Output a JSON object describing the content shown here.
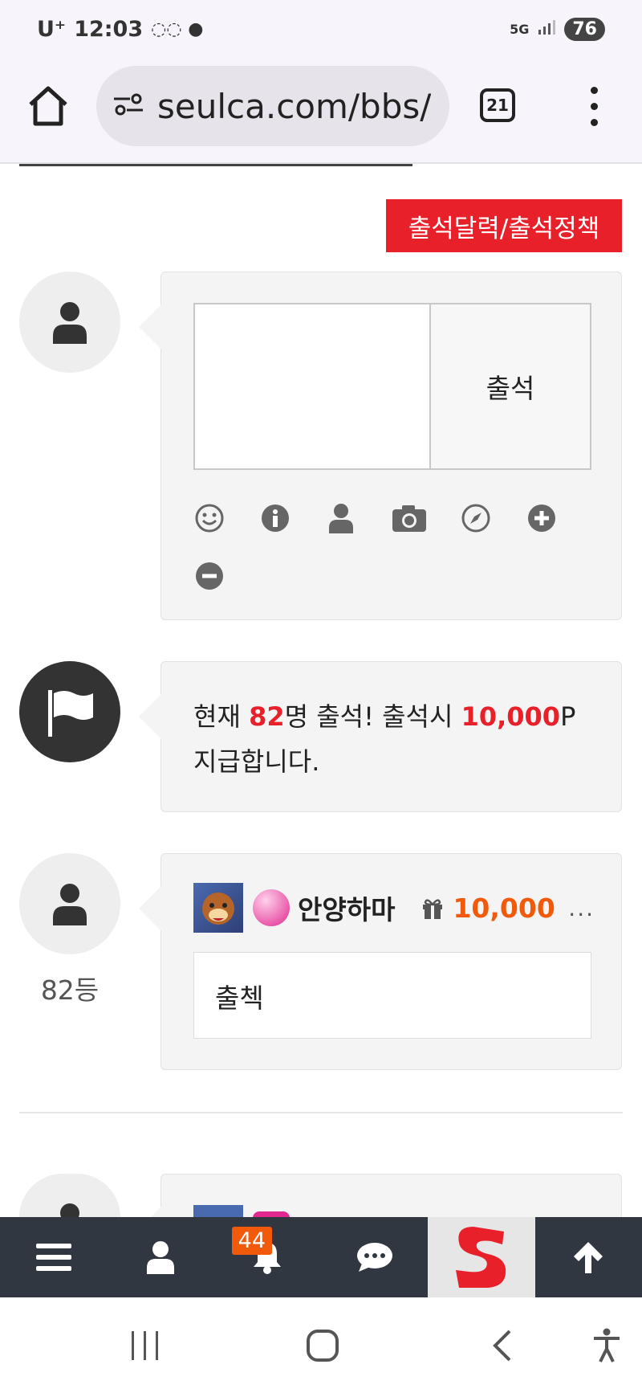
{
  "status_bar": {
    "carrier": "U⁺",
    "time": "12:03",
    "network": "5G",
    "battery": "76"
  },
  "browser": {
    "url": "seulca.com/bbs/",
    "tab_count": "21"
  },
  "page": {
    "calendar_button": "출석달력/출석정책",
    "attendance_form": {
      "submit_label": "출석",
      "input_value": "",
      "tools": [
        "smiley-icon",
        "info-icon",
        "user-icon",
        "camera-icon",
        "compass-icon",
        "plus-circle-icon",
        "minus-circle-icon"
      ]
    },
    "notice": {
      "prefix": "현재 ",
      "count": "82",
      "mid": "명 출석! 출석시 ",
      "points": "10,000",
      "suffix": "P",
      "line2": "지급합니다."
    },
    "comments": [
      {
        "rank": "82등",
        "author": "안양하마",
        "points": "10,000",
        "more": "...",
        "text": "출첵"
      }
    ]
  },
  "bottom_nav": {
    "notification_count": "44",
    "items": [
      "menu-icon",
      "user-icon",
      "bell-icon",
      "chat-icon",
      "logo",
      "arrow-up-icon"
    ]
  },
  "colors": {
    "accent_red": "#e8202a",
    "points_orange": "#f05a0a",
    "nav_bg": "#303741"
  }
}
